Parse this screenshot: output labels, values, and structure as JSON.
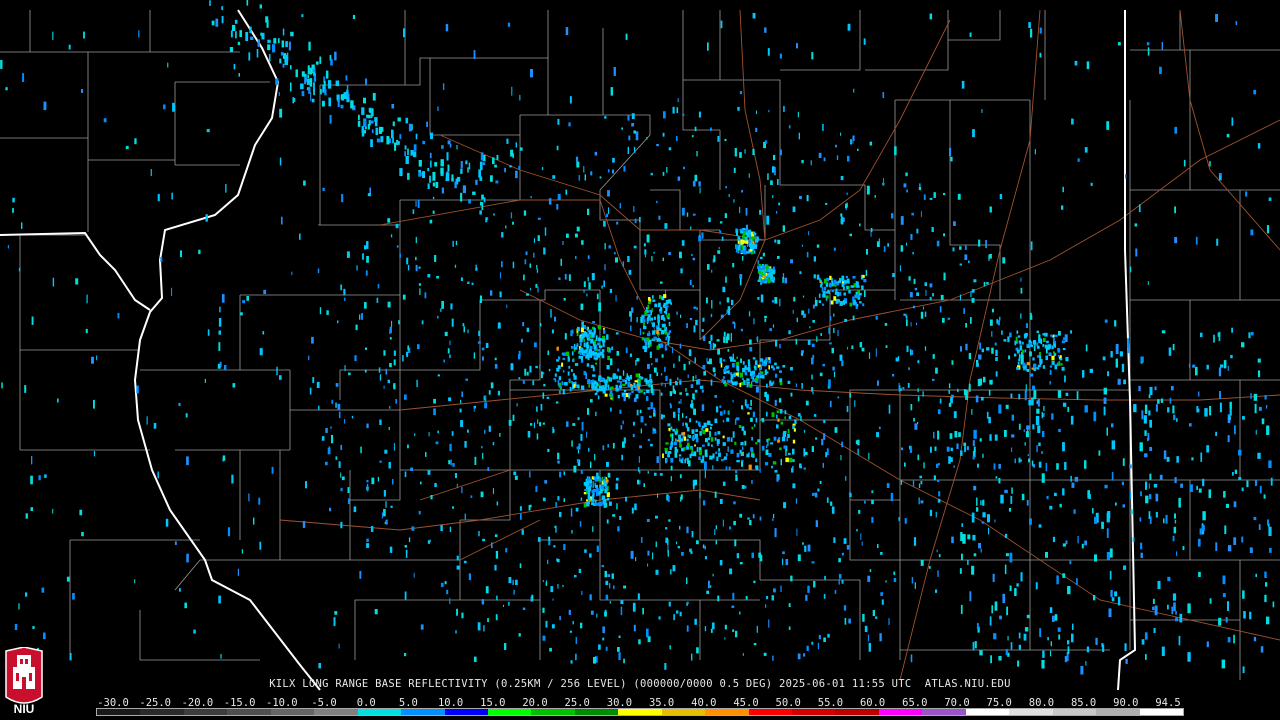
{
  "title": "KILX LONG RANGE BASE REFLECTIVITY (0.25KM / 256 LEVEL) (000000/0000 0.5 DEG) 2025-06-01 11:55 UTC  ATLAS.NIU.EDU",
  "logo": {
    "text": "NIU",
    "icon": "niu-tower-logo"
  },
  "legend": {
    "ticks": [
      "-30.0",
      "-25.0",
      "-20.0",
      "-15.0",
      "-10.0",
      "-5.0",
      "0.0",
      "5.0",
      "10.0",
      "15.0",
      "20.0",
      "25.0",
      "30.0",
      "35.0",
      "40.0",
      "45.0",
      "50.0",
      "55.0",
      "60.0",
      "65.0",
      "70.0",
      "75.0",
      "80.0",
      "85.0",
      "90.0",
      "94.5"
    ],
    "colors": [
      "#1a1a1a",
      "#2b2b2b",
      "#3d3d3d",
      "#4f4f4f",
      "#666666",
      "#808080",
      "#00e0e0",
      "#0090ff",
      "#0000ff",
      "#00ff00",
      "#00c000",
      "#008c00",
      "#ffff00",
      "#e6c000",
      "#ff9000",
      "#ff0000",
      "#d40000",
      "#bc0000",
      "#ff00ff",
      "#9955c9",
      "#ffffff",
      "#e0e0e0",
      "#c8c8c8",
      "#b0b0b0",
      "#ffffff"
    ]
  },
  "map_layers": {
    "state_border_color": "#ffffff",
    "county_border_color": "#9a9a9a",
    "highway_color": "#a0522d",
    "radar_site": "KILX"
  }
}
